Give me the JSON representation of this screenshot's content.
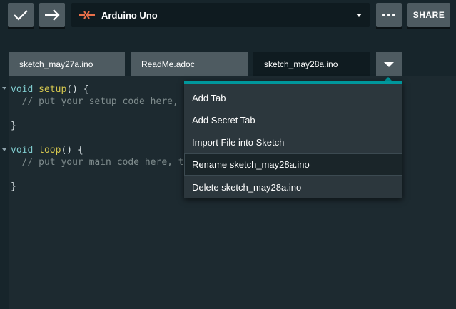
{
  "toolbar": {
    "verify_icon": "checkmark-icon",
    "upload_icon": "arrow-right-icon",
    "board_icon": "board-connection-icon",
    "board_name": "Arduino Uno",
    "more_label": "•••",
    "share_label": "SHARE"
  },
  "tabs": [
    {
      "label": "sketch_may27a.ino",
      "active": false
    },
    {
      "label": "ReadMe.adoc",
      "active": false
    },
    {
      "label": "sketch_may28a.ino",
      "active": true
    }
  ],
  "editor": {
    "lines": [
      {
        "kw": "void ",
        "fn": "setup",
        "rest": "() {"
      },
      {
        "comment": "  // put your setup code here, t"
      },
      {
        "rest": "}"
      },
      {
        "kw": "void ",
        "fn": "loop",
        "rest": "() {"
      },
      {
        "comment": "  // put your main code here, to"
      },
      {
        "rest": "}"
      }
    ]
  },
  "tab_menu": {
    "items": [
      "Add Tab",
      "Add Secret Tab",
      "Import File into Sketch",
      "Rename sketch_may28a.ino",
      "Delete sketch_may28a.ino"
    ]
  },
  "colors": {
    "accent": "#00979c",
    "background": "#17252b",
    "button": "#4e5b61"
  }
}
